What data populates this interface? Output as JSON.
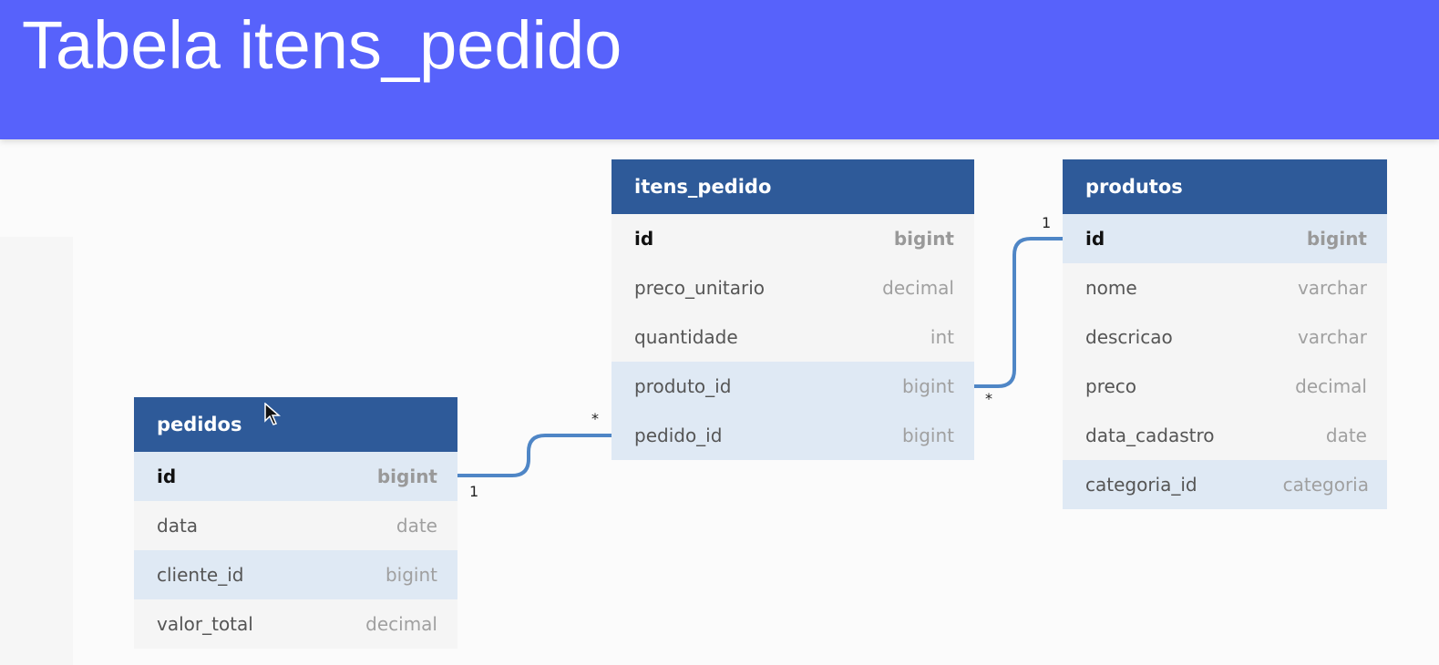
{
  "title": "Tabela itens_pedido",
  "colors": {
    "banner": "#5762fb",
    "table_header": "#2e5a99",
    "row_highlight": "#dfe9f4",
    "link": "#4f86c6"
  },
  "tables": {
    "pedidos": {
      "name": "pedidos",
      "rows": [
        {
          "name": "id",
          "type": "bigint"
        },
        {
          "name": "data",
          "type": "date"
        },
        {
          "name": "cliente_id",
          "type": "bigint"
        },
        {
          "name": "valor_total",
          "type": "decimal"
        }
      ]
    },
    "itens_pedido": {
      "name": "itens_pedido",
      "rows": [
        {
          "name": "id",
          "type": "bigint"
        },
        {
          "name": "preco_unitario",
          "type": "decimal"
        },
        {
          "name": "quantidade",
          "type": "int"
        },
        {
          "name": "produto_id",
          "type": "bigint"
        },
        {
          "name": "pedido_id",
          "type": "bigint"
        }
      ]
    },
    "produtos": {
      "name": "produtos",
      "rows": [
        {
          "name": "id",
          "type": "bigint"
        },
        {
          "name": "nome",
          "type": "varchar"
        },
        {
          "name": "descricao",
          "type": "varchar"
        },
        {
          "name": "preco",
          "type": "decimal"
        },
        {
          "name": "data_cadastro",
          "type": "date"
        },
        {
          "name": "categoria_id",
          "type": "categoria"
        }
      ]
    }
  },
  "relations": [
    {
      "from": "pedidos.id",
      "to": "itens_pedido.pedido_id",
      "from_card": "1",
      "to_card": "*"
    },
    {
      "from": "itens_pedido.produto_id",
      "to": "produtos.id",
      "from_card": "*",
      "to_card": "1"
    }
  ]
}
